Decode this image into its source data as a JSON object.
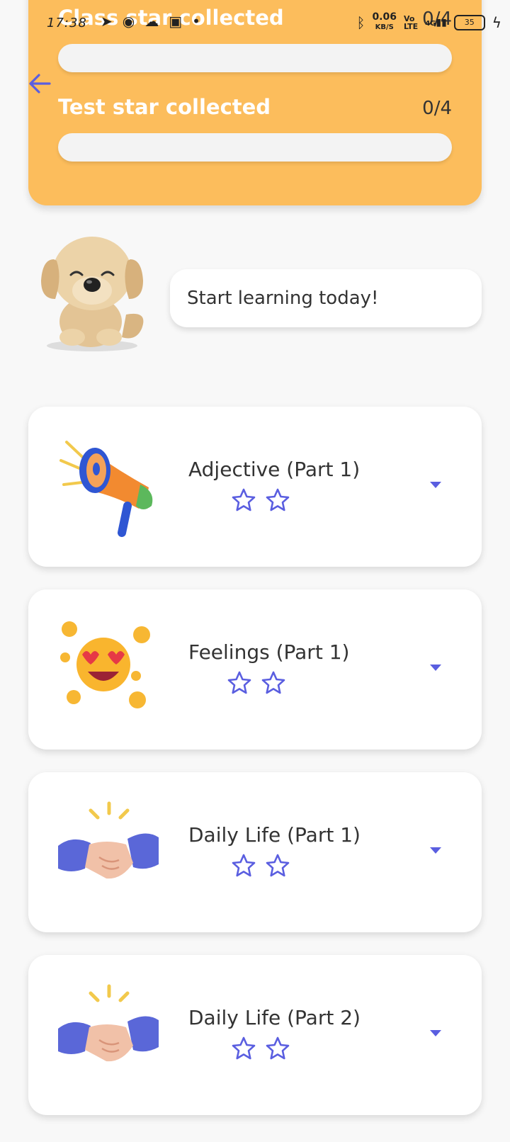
{
  "status_bar": {
    "time": "17:38",
    "speed_value": "0.06",
    "speed_unit": "KB/S",
    "network": "4G",
    "battery": "35"
  },
  "progress": {
    "class_label": "Class star collected",
    "class_count": "0/4",
    "class_fraction": 0,
    "test_label": "Test star collected",
    "test_count": "0/4",
    "test_fraction": 0
  },
  "mascot": {
    "message": "Start learning today!"
  },
  "lessons": [
    {
      "title": "Adjective (Part 1)",
      "icon": "megaphone-icon",
      "stars_earned": 0,
      "stars_total": 2
    },
    {
      "title": "Feelings (Part 1)",
      "icon": "heart-eyes-emoji-icon",
      "stars_earned": 0,
      "stars_total": 2
    },
    {
      "title": "Daily Life (Part 1)",
      "icon": "handshake-icon",
      "stars_earned": 0,
      "stars_total": 2
    },
    {
      "title": "Daily Life (Part 2)",
      "icon": "handshake-icon",
      "stars_earned": 0,
      "stars_total": 2
    }
  ],
  "colors": {
    "accent": "#5a5ee0",
    "card_orange": "#fcbd5c",
    "background": "#f8f8f8"
  }
}
